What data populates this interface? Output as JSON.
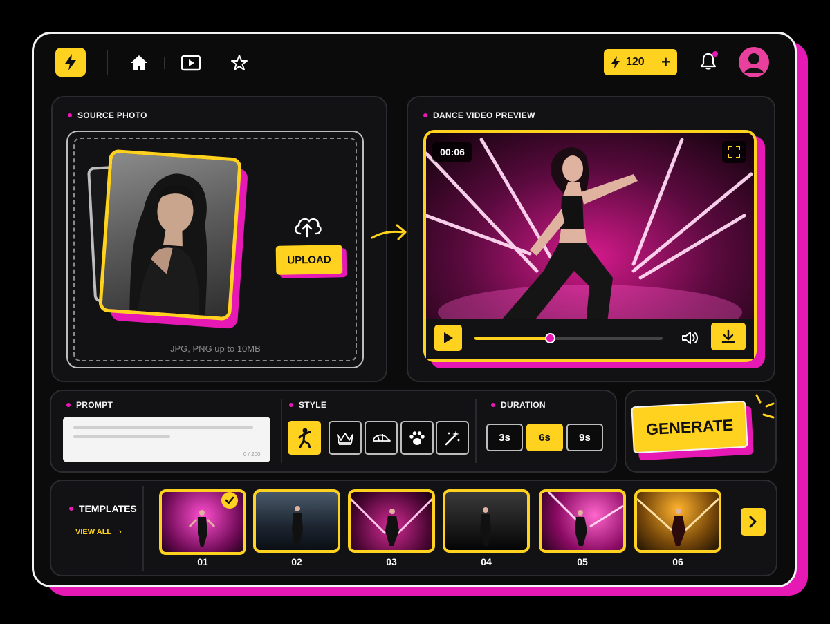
{
  "header": {
    "credits": "120",
    "credits_add": "+",
    "nav": [
      "home-icon",
      "video-icon",
      "star-icon"
    ]
  },
  "source": {
    "label": "SOURCE PHOTO",
    "upload_label": "UPLOAD",
    "hint": "JPG, PNG up to 10MB"
  },
  "preview": {
    "label": "DANCE VIDEO PREVIEW",
    "time": "00:06",
    "progress": 0.4
  },
  "prompt": {
    "label": "PROMPT",
    "counter": "0 / 200"
  },
  "style": {
    "label": "STYLE",
    "options": [
      "dance-icon",
      "crown-icon",
      "cap-icon",
      "paw-icon",
      "magic-wand-icon"
    ],
    "selected": 0
  },
  "duration": {
    "label": "DURATION",
    "options": [
      "3s",
      "6s",
      "9s"
    ],
    "selected": "6s"
  },
  "generate_label": "GENERATE",
  "templates": {
    "title": "TEMPLATES",
    "view_all": "VIEW ALL",
    "items": [
      {
        "num": "01"
      },
      {
        "num": "02"
      },
      {
        "num": "03"
      },
      {
        "num": "04"
      },
      {
        "num": "05"
      },
      {
        "num": "06"
      }
    ],
    "selected": "01"
  },
  "colors": {
    "accent": "#ffd21f",
    "magenta": "#e619b4",
    "background": "#0b0b0c"
  }
}
